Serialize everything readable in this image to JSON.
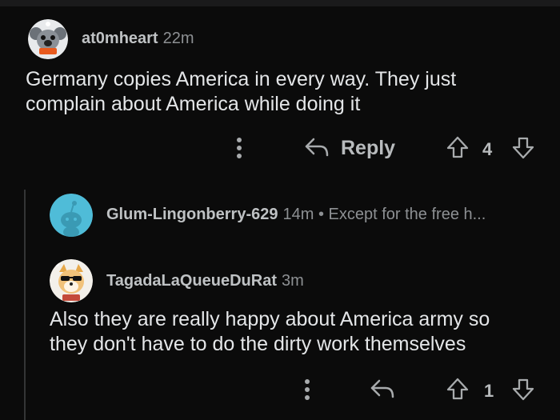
{
  "comments": [
    {
      "username": "at0mheart",
      "time": "22m",
      "body_line1": "Germany copies America in every way. They just",
      "body_line2": "complain about America while doing it",
      "reply_label": "Reply",
      "votes": "4"
    },
    {
      "username": "Glum-Lingonberry-629",
      "time": "14m",
      "separator": "•",
      "snippet": "Except for the free h..."
    },
    {
      "username": "TagadaLaQueueDuRat",
      "time": "3m",
      "body_line1": "Also they are really happy about America army so",
      "body_line2": "they don't have to do the dirty work themselves",
      "votes": "1"
    }
  ],
  "icons": {
    "more": "more-options-icon",
    "reply": "reply-arrow-icon",
    "upvote": "upvote-arrow-icon",
    "downvote": "downvote-arrow-icon"
  },
  "colors": {
    "background": "#0b0b0b",
    "text": "#e4e6e8",
    "muted": "#8d9093",
    "thread_line": "#343536",
    "avatar_blue": "#4fbcd8"
  }
}
